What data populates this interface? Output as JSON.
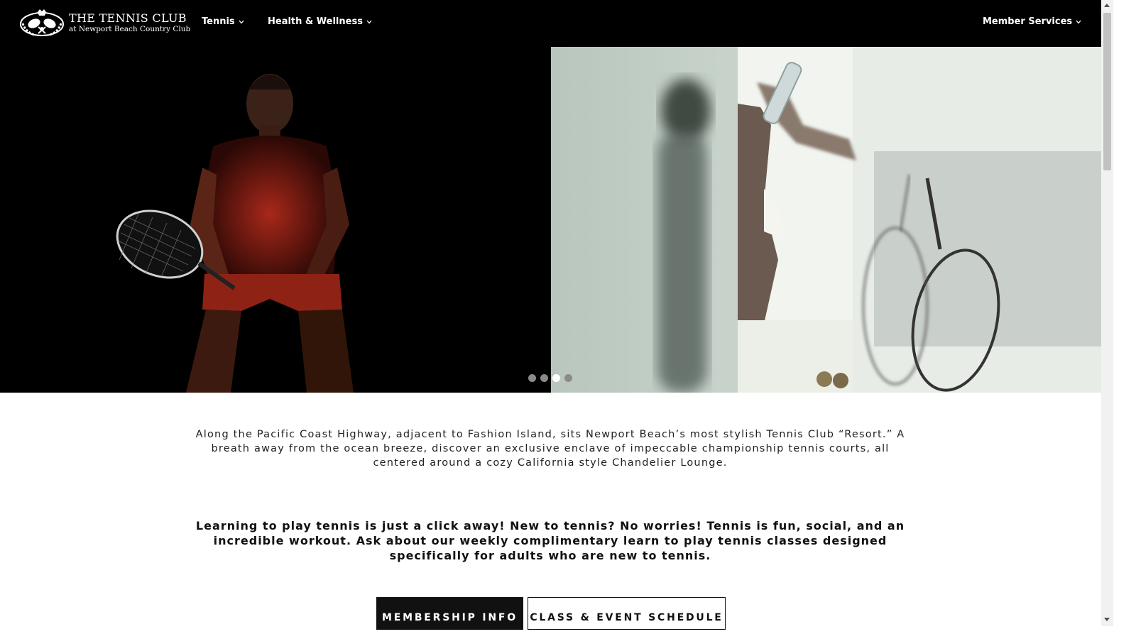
{
  "header": {
    "logo_title": "THE TENNIS CLUB",
    "logo_subtitle": "at Newport Beach Country Club",
    "nav": {
      "tennis": "Tennis",
      "health": "Health & Wellness",
      "member_services": "Member Services"
    }
  },
  "hero": {
    "slide_count": 4,
    "active_slide": 3
  },
  "intro": {
    "text": "Along the Pacific Coast Highway, adjacent to Fashion Island, sits Newport Beach’s most stylish Tennis Club “Resort.” A breath away from the ocean breeze, discover an exclusive enclave of impeccable championship tennis courts, all centered around a cozy California style Chandelier Lounge."
  },
  "learn": {
    "text": "Learning to play tennis is just a click away! New to tennis? No worries! Tennis is fun, social, and an incredible workout. Ask about our weekly complimentary learn to play tennis classes designed specifically for adults who are new to tennis."
  },
  "buttons": {
    "membership": "MEMBERSHIP INFO",
    "schedule": "CLASS & EVENT SCHEDULE"
  },
  "icons": {
    "logo": "crest-emblem-icon",
    "chevron": "chevron-down-icon"
  },
  "colors": {
    "header_bg": "#000000",
    "accent_red": "#b8321f",
    "button_dark": "#111111"
  }
}
